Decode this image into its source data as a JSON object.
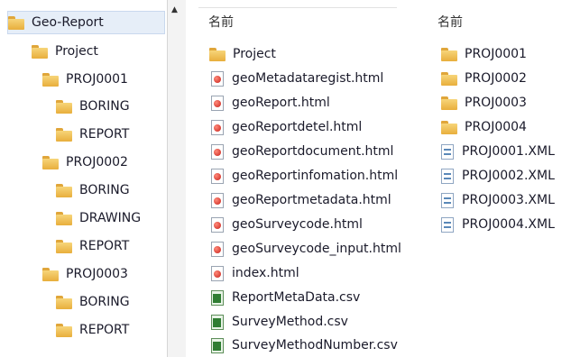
{
  "tree": {
    "items": [
      {
        "label": "Geo-Report",
        "level": 0
      },
      {
        "label": "Project",
        "level": 1
      },
      {
        "label": "PROJ0001",
        "level": 2
      },
      {
        "label": "BORING",
        "level": 3
      },
      {
        "label": "REPORT",
        "level": 3
      },
      {
        "label": "PROJ0002",
        "level": 2
      },
      {
        "label": "BORING",
        "level": 3
      },
      {
        "label": "DRAWING",
        "level": 3
      },
      {
        "label": "REPORT",
        "level": 3
      },
      {
        "label": "PROJ0003",
        "level": 2
      },
      {
        "label": "BORING",
        "level": 3
      },
      {
        "label": "REPORT",
        "level": 3
      }
    ]
  },
  "column1": {
    "header": "名前",
    "files": [
      {
        "name": "Project",
        "icon": "folder"
      },
      {
        "name": "geoMetadataregist.html",
        "icon": "html"
      },
      {
        "name": "geoReport.html",
        "icon": "html"
      },
      {
        "name": "geoReportdetel.html",
        "icon": "html"
      },
      {
        "name": "geoReportdocument.html",
        "icon": "html"
      },
      {
        "name": "geoReportinfomation.html",
        "icon": "html"
      },
      {
        "name": "geoReportmetadata.html",
        "icon": "html"
      },
      {
        "name": "geoSurveycode.html",
        "icon": "html"
      },
      {
        "name": "geoSurveycode_input.html",
        "icon": "html"
      },
      {
        "name": "index.html",
        "icon": "html"
      },
      {
        "name": "ReportMetaData.csv",
        "icon": "csv"
      },
      {
        "name": "SurveyMethod.csv",
        "icon": "csv"
      },
      {
        "name": "SurveyMethodNumber.csv",
        "icon": "csv"
      }
    ]
  },
  "column2": {
    "header": "名前",
    "files": [
      {
        "name": "PROJ0001",
        "icon": "folder"
      },
      {
        "name": "PROJ0002",
        "icon": "folder"
      },
      {
        "name": "PROJ0003",
        "icon": "folder"
      },
      {
        "name": "PROJ0004",
        "icon": "folder"
      },
      {
        "name": "PROJ0001.XML",
        "icon": "xml"
      },
      {
        "name": "PROJ0002.XML",
        "icon": "xml"
      },
      {
        "name": "PROJ0003.XML",
        "icon": "xml"
      },
      {
        "name": "PROJ0004.XML",
        "icon": "xml"
      }
    ]
  }
}
